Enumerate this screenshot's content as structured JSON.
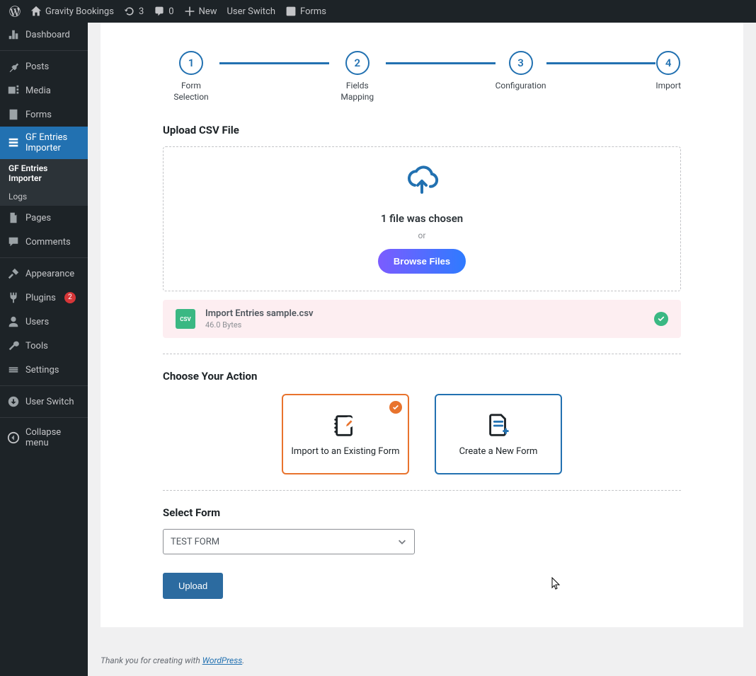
{
  "adminBar": {
    "siteName": "Gravity Bookings",
    "updates": "3",
    "comments": "0",
    "new": "New",
    "userSwitch": "User Switch",
    "forms": "Forms"
  },
  "sidebar": {
    "dashboard": "Dashboard",
    "posts": "Posts",
    "media": "Media",
    "forms": "Forms",
    "gfImporter": "GF Entries Importer",
    "sub": {
      "importer": "GF Entries Importer",
      "logs": "Logs"
    },
    "pages": "Pages",
    "commentsLabel": "Comments",
    "appearance": "Appearance",
    "plugins": "Plugins",
    "pluginsCount": "2",
    "users": "Users",
    "tools": "Tools",
    "settings": "Settings",
    "userSwitch": "User Switch",
    "collapse": "Collapse menu"
  },
  "steps": {
    "s1": {
      "n": "1",
      "label": "Form Selection"
    },
    "s2": {
      "n": "2",
      "label": "Fields Mapping"
    },
    "s3": {
      "n": "3",
      "label": "Configuration"
    },
    "s4": {
      "n": "4",
      "label": "Import"
    }
  },
  "upload": {
    "title": "Upload CSV File",
    "statusText": "1 file was chosen",
    "orText": "or",
    "browse": "Browse Files",
    "file": {
      "name": "Import Entries sample.csv",
      "size": "46.0 Bytes",
      "iconLabel": "CSV"
    }
  },
  "actionSection": {
    "title": "Choose Your Action",
    "existing": "Import to an Existing Form",
    "createNew": "Create a New Form"
  },
  "selectForm": {
    "title": "Select Form",
    "selected": "TEST FORM"
  },
  "buttons": {
    "upload": "Upload"
  },
  "footer": {
    "prefix": "Thank you for creating with ",
    "link": "WordPress",
    "suffix": "."
  }
}
